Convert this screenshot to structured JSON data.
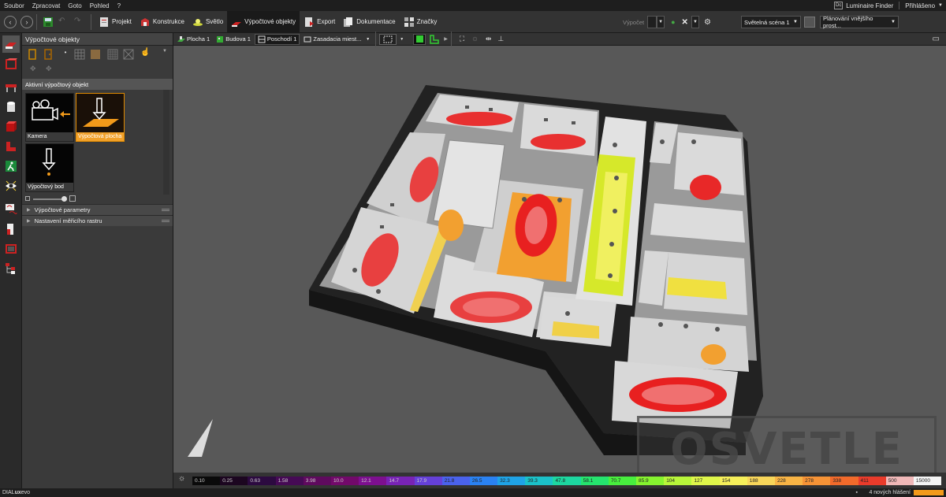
{
  "menu": {
    "items": [
      "Soubor",
      "Zpracovat",
      "Goto",
      "Pohled",
      "?"
    ],
    "luminaire_finder": "Luminaire Finder",
    "login": "Přihlášeno",
    "lf_badge": "Dc"
  },
  "toolbar": {
    "tabs": [
      {
        "label": "Projekt",
        "icon": "project-icon"
      },
      {
        "label": "Konstrukce",
        "icon": "construction-icon"
      },
      {
        "label": "Světlo",
        "icon": "light-icon"
      },
      {
        "label": "Výpočtové objekty",
        "icon": "calc-objects-icon"
      },
      {
        "label": "Export",
        "icon": "export-icon"
      },
      {
        "label": "Dokumentace",
        "icon": "documentation-icon"
      },
      {
        "label": "Značky",
        "icon": "marks-icon"
      }
    ],
    "calc_label": "Výpočet",
    "scene_select": "Světelná scéna 1",
    "exterior_select": "Plánování vnějšího prost..."
  },
  "panel": {
    "title": "Výpočtové objekty",
    "active_section": "Aktivní výpočtový objekt",
    "objects": [
      {
        "label": "Kamera"
      },
      {
        "label": "Výpočtová plocha"
      },
      {
        "label": "Výpočtový bod"
      }
    ],
    "collapsed_sections": [
      "Výpočtové parametry",
      "Nastavení měřicího rastru"
    ]
  },
  "viewport": {
    "breadcrumbs": [
      "Plocha 1",
      "Budova 1",
      "Poschodí 1",
      "Zasadacia miest..."
    ]
  },
  "legend": {
    "values": [
      "0.10",
      "0.25",
      "0.63",
      "1.58",
      "3.98",
      "10.0",
      "12.1",
      "14.7",
      "17.9",
      "21.8",
      "26.5",
      "32.3",
      "39.3",
      "47.8",
      "58.1",
      "70.7",
      "85.9",
      "104",
      "127",
      "154",
      "188",
      "228",
      "278",
      "338",
      "411",
      "500",
      "15000"
    ],
    "colors": [
      "#0a0a0a",
      "#1c0620",
      "#2c0a40",
      "#460a55",
      "#5f0a5e",
      "#72096a",
      "#7d0f8f",
      "#7823b5",
      "#6540d8",
      "#4a62ec",
      "#2a82f2",
      "#1fa3e6",
      "#1bc1c8",
      "#1dd7a0",
      "#25e46e",
      "#48ee3e",
      "#86f32f",
      "#b8f63a",
      "#dff64a",
      "#f6ef5a",
      "#f8d65a",
      "#f8b445",
      "#f69336",
      "#f26a2b",
      "#ea3b2b",
      "#f0b8b8",
      "#f4f4f4"
    ]
  },
  "status": {
    "brand_a": "DIAL",
    "brand_b": "ux",
    "brand_c": "evo",
    "notifications": "4 nových hlášení"
  },
  "watermark": "OSVETLE"
}
